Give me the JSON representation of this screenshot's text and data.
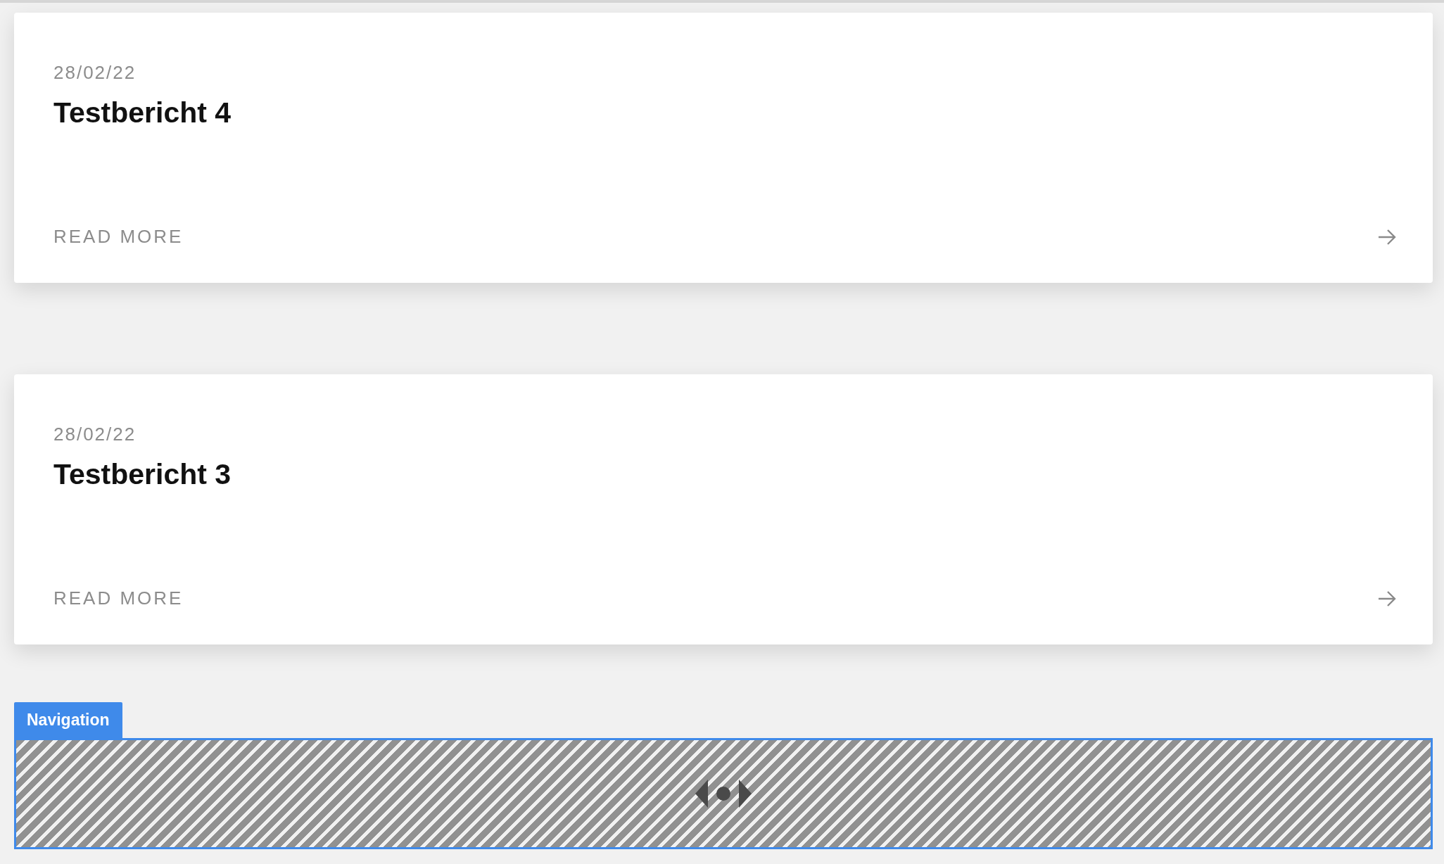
{
  "posts": [
    {
      "date": "28/02/22",
      "title": "Testbericht 4",
      "link": "READ MORE"
    },
    {
      "date": "28/02/22",
      "title": "Testbericht 3",
      "link": "READ MORE"
    }
  ],
  "navigation": {
    "label": "Navigation"
  }
}
